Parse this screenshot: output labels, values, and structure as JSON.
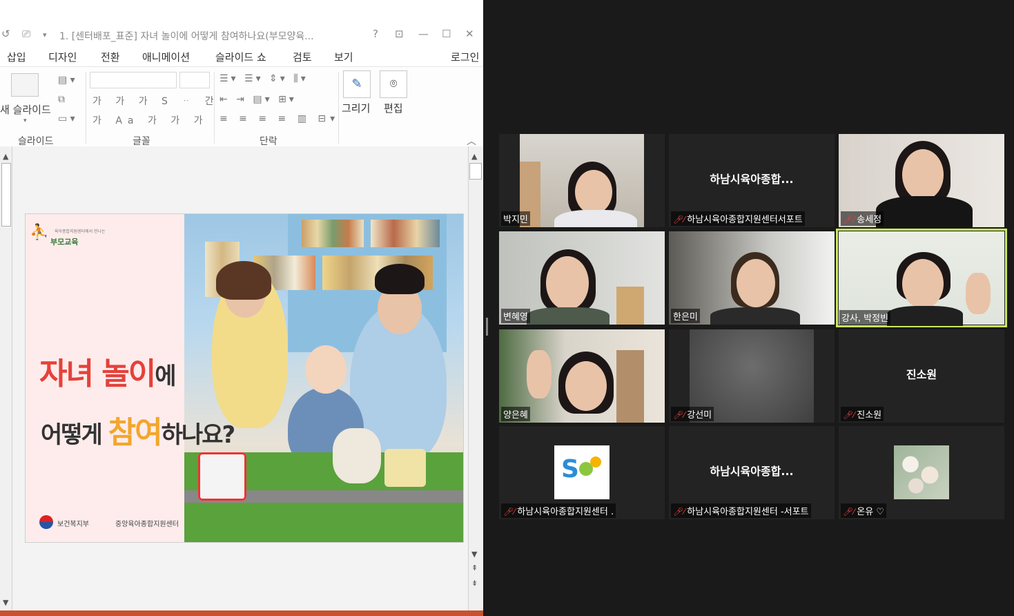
{
  "powerpoint": {
    "window_title": "1. [센터배포_표준] 자녀 놀이에 어떻게 참여하나요(부모양육...",
    "title_controls": {
      "help": "?",
      "minimize": "—",
      "maximize": "☐",
      "close": "✕"
    },
    "menu_tabs": [
      "삽입",
      "디자인",
      "전환",
      "애니메이션",
      "슬라이드 쇼",
      "검토",
      "보기"
    ],
    "login_label": "로그인",
    "ribbon": {
      "new_slide_label": "새 슬라이드",
      "group_slide": "슬라이드",
      "group_font": "글꼴",
      "group_paragraph": "단락",
      "draw_label": "그리기",
      "edit_label": "편집",
      "font_buttons": [
        "가",
        "가",
        "가",
        "S",
        "ᆢ",
        "간",
        "가",
        "Aa",
        "가",
        "가",
        "가"
      ]
    },
    "slide": {
      "logo_sub": "육아종합지원센터에서 만나는",
      "logo_text": "부모교육",
      "title_line1_red": "자녀 놀이",
      "title_line1_black": "에",
      "title_line2_a": "어떻게 ",
      "title_line2_orange": "참여",
      "title_line2_b": "하나요?",
      "footer_left": "보건복지부",
      "footer_right": "중앙육아종합지원센터"
    }
  },
  "meeting": {
    "participants": [
      {
        "name": "박지민",
        "muted": false,
        "video": true
      },
      {
        "name": "하남시육아종합지원센터서포트",
        "center_label": "하남시육아종합...",
        "muted": true,
        "video": false
      },
      {
        "name": "송세정",
        "muted": true,
        "video": true
      },
      {
        "name": "변혜영",
        "muted": false,
        "video": true
      },
      {
        "name": "한은미",
        "muted": false,
        "video": true
      },
      {
        "name": "강사, 박정빈",
        "muted": false,
        "video": true,
        "active": true
      },
      {
        "name": "양은혜",
        "muted": false,
        "video": true
      },
      {
        "name": "강선미",
        "muted": true,
        "video": true
      },
      {
        "name": "진소원",
        "center_label": "진소원",
        "muted": true,
        "video": false
      },
      {
        "name": "하남시육아종합지원센터 .",
        "muted": true,
        "video": false,
        "avatar": "logo"
      },
      {
        "name": "하남시육아종합지원센터 -서포트",
        "center_label": "하남시육아종합...",
        "muted": true,
        "video": false
      },
      {
        "name": "온유 ♡",
        "muted": true,
        "video": false,
        "avatar": "flowers"
      }
    ]
  },
  "colors": {
    "accent_active": "#c8e85f",
    "mute_red": "#e34040",
    "slide_title_red": "#e5413b",
    "slide_title_orange": "#f2a62c",
    "status_bar": "#c9512f"
  }
}
